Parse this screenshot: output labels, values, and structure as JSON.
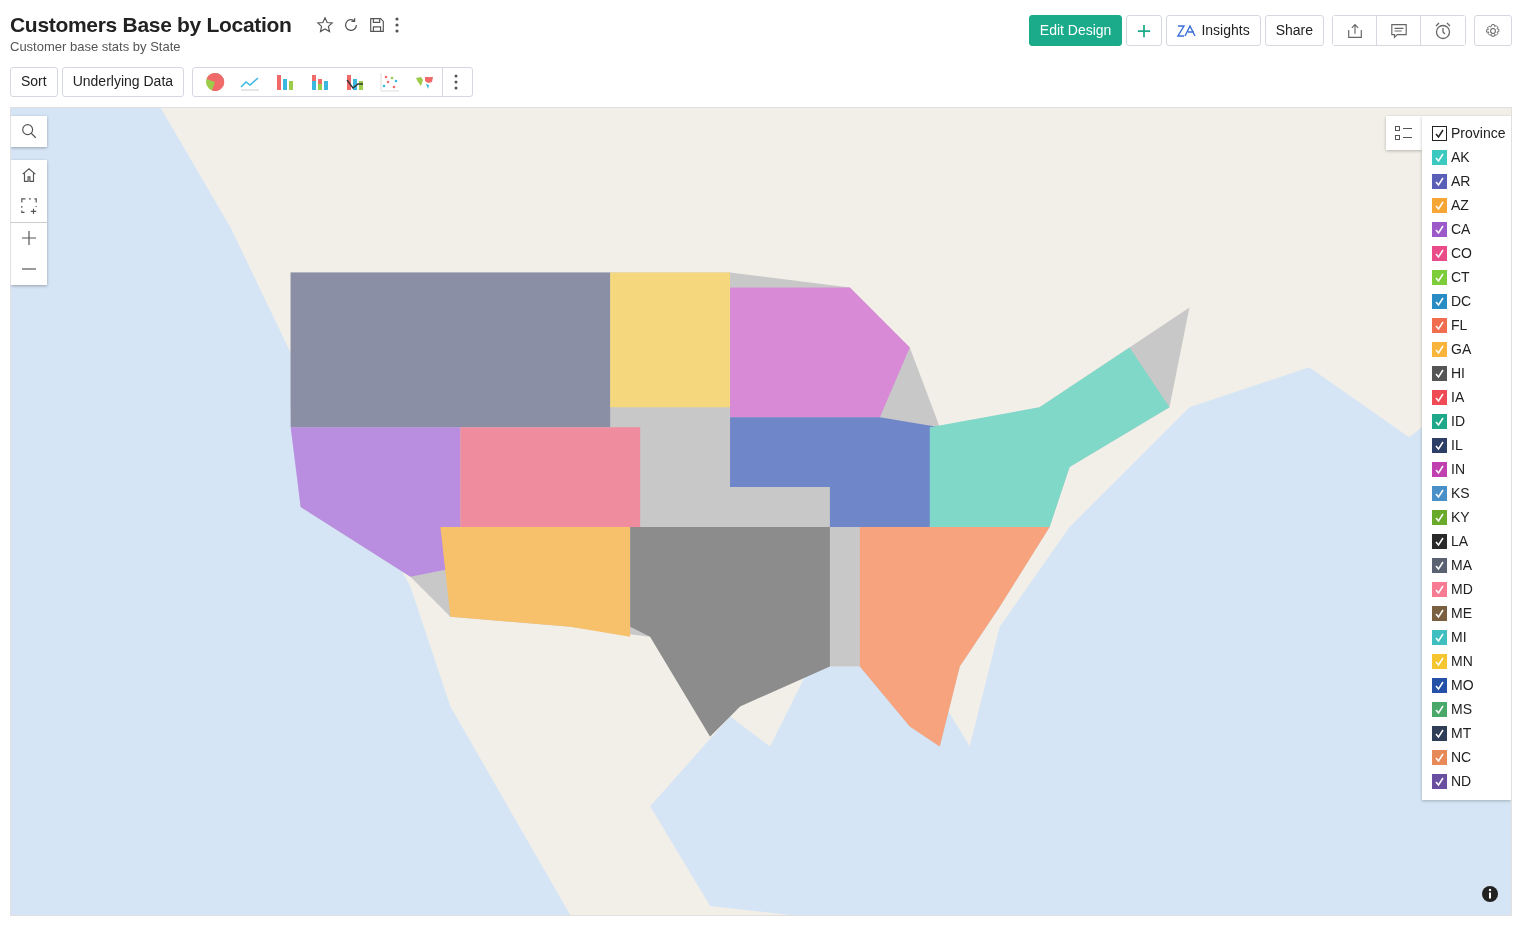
{
  "header": {
    "title": "Customers Base by Location",
    "subtitle": "Customer base stats by State"
  },
  "actions": [
    {
      "kind": "primary",
      "label": "Edit Design"
    },
    {
      "kind": "add"
    },
    {
      "kind": "insights",
      "label": "Insights"
    },
    {
      "kind": "plain",
      "label": "Share"
    }
  ],
  "toolbar": {
    "buttons": [
      "Sort",
      "Underlying Data"
    ],
    "chart_types": [
      {
        "kind": "pie"
      },
      {
        "kind": "line"
      },
      {
        "kind": "bar"
      },
      {
        "kind": "stacked"
      },
      {
        "kind": "combo"
      },
      {
        "kind": "scatter"
      },
      {
        "kind": "map"
      }
    ]
  },
  "legend": {
    "title": "Province",
    "checked": true,
    "items": [
      {
        "label": "AK",
        "checked": true,
        "color": "#3cc9c0"
      },
      {
        "label": "AR",
        "checked": true,
        "color": "#5a5fb8"
      },
      {
        "label": "AZ",
        "checked": true,
        "color": "#f7a535"
      },
      {
        "label": "CA",
        "checked": true,
        "color": "#9b59c9"
      },
      {
        "label": "CO",
        "checked": true,
        "color": "#ea4c89"
      },
      {
        "label": "CT",
        "checked": true,
        "color": "#7dcc3a"
      },
      {
        "label": "DC",
        "checked": true,
        "color": "#2a8cc4"
      },
      {
        "label": "FL",
        "checked": true,
        "color": "#f06d4f"
      },
      {
        "label": "GA",
        "checked": true,
        "color": "#f9b43c"
      },
      {
        "label": "HI",
        "checked": true,
        "color": "#555555"
      },
      {
        "label": "IA",
        "checked": true,
        "color": "#ef4a55"
      },
      {
        "label": "ID",
        "checked": true,
        "color": "#1fa88a"
      },
      {
        "label": "IL",
        "checked": true,
        "color": "#2c3e66"
      },
      {
        "label": "IN",
        "checked": true,
        "color": "#c040b0"
      },
      {
        "label": "KS",
        "checked": true,
        "color": "#4a90c8"
      },
      {
        "label": "KY",
        "checked": true,
        "color": "#6aaa2a"
      },
      {
        "label": "LA",
        "checked": true,
        "color": "#2a2a2a"
      },
      {
        "label": "MA",
        "checked": true,
        "color": "#5a6170"
      },
      {
        "label": "MD",
        "checked": true,
        "color": "#f77b92"
      },
      {
        "label": "ME",
        "checked": true,
        "color": "#7a6040"
      },
      {
        "label": "MI",
        "checked": true,
        "color": "#3fbfbf"
      },
      {
        "label": "MN",
        "checked": true,
        "color": "#f5c630"
      },
      {
        "label": "MO",
        "checked": true,
        "color": "#2450a8"
      },
      {
        "label": "MS",
        "checked": true,
        "color": "#4aa86a"
      },
      {
        "label": "MT",
        "checked": true,
        "color": "#2f3e56"
      },
      {
        "label": "NC",
        "checked": true,
        "color": "#e8895a"
      },
      {
        "label": "ND",
        "checked": true,
        "color": "#6a4ea0"
      }
    ]
  }
}
